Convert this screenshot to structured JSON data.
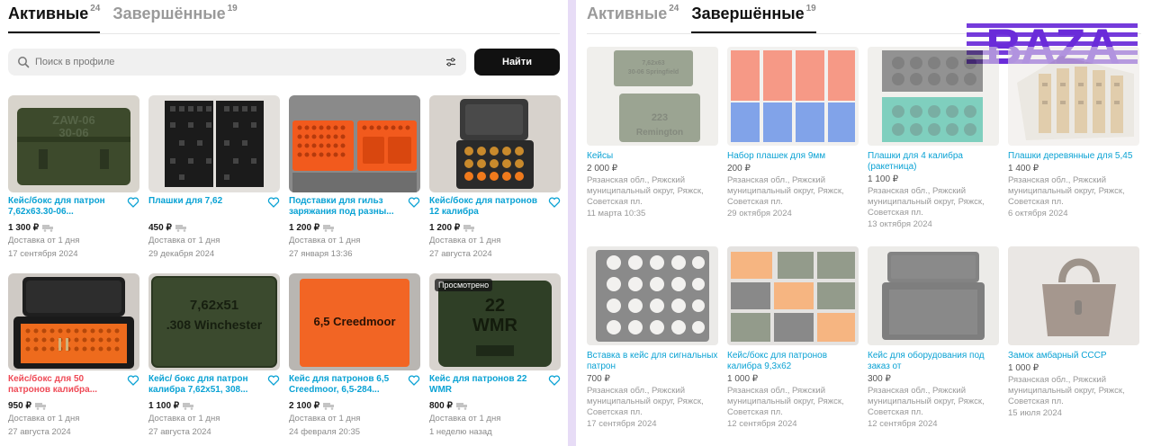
{
  "left": {
    "tabs": [
      {
        "label": "Активные",
        "count": "24"
      },
      {
        "label": "Завершённые",
        "count": "19"
      }
    ],
    "search": {
      "placeholder": "Поиск в профиле",
      "button": "Найти"
    },
    "cards": [
      {
        "title": "Кейс/бокс для патрон 7,62х63.30-06...",
        "price": "1 300 ₽",
        "delivery": "Доставка от 1 дня",
        "date": "17 сентября 2024",
        "title_color": "#0aa2d4"
      },
      {
        "title": "Плашки для 7,62",
        "price": "450 ₽",
        "delivery": "Доставка от 1 дня",
        "date": "29 декабря 2024",
        "title_color": "#0aa2d4"
      },
      {
        "title": "Подставки для гильз заряжания под разны...",
        "price": "1 200 ₽",
        "delivery": "Доставка от 1 дня",
        "date": "27 января 13:36",
        "title_color": "#0aa2d4"
      },
      {
        "title": "Кейс/бокс для патронов 12 калибра",
        "price": "1 200 ₽",
        "delivery": "Доставка от 1 дня",
        "date": "27 августа 2024",
        "title_color": "#0aa2d4"
      },
      {
        "title": "Кейс/бокс для 50 патронов калибра...",
        "price": "950 ₽",
        "delivery": "Доставка от 1 дня",
        "date": "27 августа 2024",
        "title_color": "#ef4a56"
      },
      {
        "title": "Кейс/ бокс для патрон калибра 7,62х51, 308...",
        "price": "1 100 ₽",
        "delivery": "Доставка от 1 дня",
        "date": "27 августа 2024",
        "title_color": "#0aa2d4"
      },
      {
        "title": "Кейс для патронов 6,5 Creedmoor, 6,5-284...",
        "price": "2 100 ₽",
        "delivery": "Доставка от 1 дня",
        "date": "24 февраля 20:35",
        "title_color": "#0aa2d4"
      },
      {
        "title": "Кейс для патронов 22 WMR",
        "price": "800 ₽",
        "delivery": "Доставка от 1 дня",
        "date": "1 неделю назад",
        "title_color": "#0aa2d4",
        "badge": "Просмотрено"
      }
    ],
    "thumb_text": {
      "c1a": "ZAW-06",
      "c1b": "30-06",
      "c6a": "7,62x51",
      "c6b": ".308 Winchester",
      "c7a": "6,5 Creedmoor",
      "c8a": "22",
      "c8b": "WMR"
    }
  },
  "right": {
    "tabs": [
      {
        "label": "Активные",
        "count": "24"
      },
      {
        "label": "Завершённые",
        "count": "19"
      }
    ],
    "logo": "BAZA",
    "cards": [
      {
        "title": "Кейсы",
        "price": "2 000 ₽",
        "location": "Рязанская обл., Ряжский муниципальный округ, Ряжск, Советская пл.",
        "date": "11 марта 10:35"
      },
      {
        "title": "Набор плашек для 9мм",
        "price": "200 ₽",
        "location": "Рязанская обл., Ряжский муниципальный округ, Ряжск, Советская пл.",
        "date": "29 октября 2024"
      },
      {
        "title": "Плашки для 4 калибра (ракетница)",
        "price": "1 100 ₽",
        "location": "Рязанская обл., Ряжский муниципальный округ, Ряжск, Советская пл.",
        "date": "13 октября 2024"
      },
      {
        "title": "Плашки деревянные для 5,45",
        "price": "1 400 ₽",
        "location": "Рязанская обл., Ряжский муниципальный округ, Ряжск, Советская пл.",
        "date": "6 октября 2024"
      },
      {
        "title": "Вставка в кейс для сигнальных патрон",
        "price": "700 ₽",
        "location": "Рязанская обл., Ряжский муниципальный округ, Ряжск, Советская пл.",
        "date": "17 сентября 2024"
      },
      {
        "title": "Кейс/бокс для патронов калибра 9,3х62",
        "price": "1 000 ₽",
        "location": "Рязанская обл., Ряжский муниципальный округ, Ряжск, Советская пл.",
        "date": "12 сентября 2024"
      },
      {
        "title": "Кейс для оборудования под заказ от",
        "price": "300 ₽",
        "location": "Рязанская обл., Ряжский муниципальный округ, Ряжск, Советская пл.",
        "date": "12 сентября 2024"
      },
      {
        "title": "Замок амбарный СССР",
        "price": "1 000 ₽",
        "location": "Рязанская обл., Ряжский муниципальный округ, Ряжск, Советская пл.",
        "date": "15 июля 2024"
      }
    ],
    "thumb_text": {
      "r1a": "7,62x63",
      "r1b": "30-06 Springfield",
      "r1c": "223",
      "r1d": "Remington"
    }
  },
  "colors": {
    "link": "#0aa2d4",
    "red_link": "#ef4a56",
    "divider": "#e7dcf6",
    "logo": "#6a2bd9"
  }
}
